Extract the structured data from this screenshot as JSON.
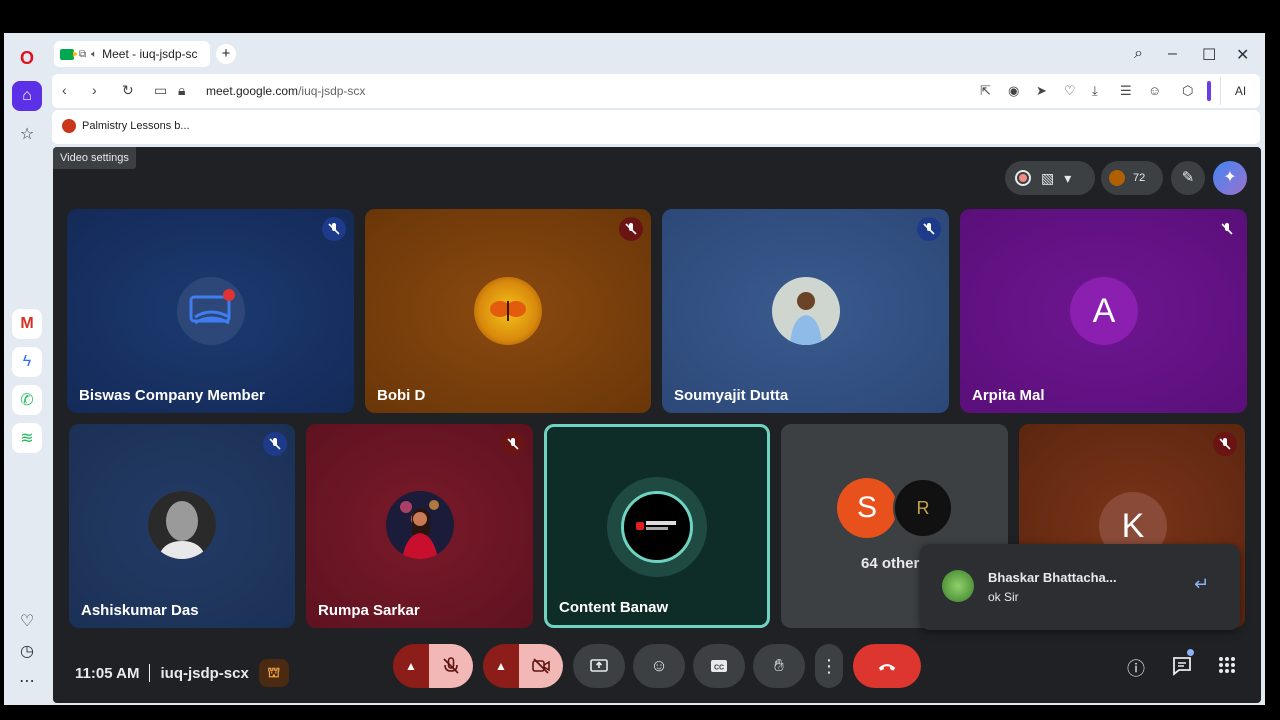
{
  "browser": {
    "tab_title": "Meet - iuq-jsdp-sc",
    "new_tab": "+",
    "url_host": "meet.google.com",
    "url_path": "/iuq-jsdp-scx",
    "ai_label": "AI",
    "bookmark": "Palmistry Lessons b..."
  },
  "meet": {
    "video_settings_tip": "Video settings",
    "participant_count": "72",
    "tiles": [
      {
        "name": "Biswas Company Member",
        "muted": true
      },
      {
        "name": "Bobi D",
        "muted": true
      },
      {
        "name": "Soumyajit Dutta",
        "muted": true
      },
      {
        "name": "Arpita Mal",
        "avatar_letter": "A",
        "muted": true
      },
      {
        "name": "Ashiskumar Das",
        "muted": true
      },
      {
        "name": "Rumpa Sarkar",
        "muted": true
      },
      {
        "name": "Content Banaw",
        "active_speaker": true
      },
      {
        "name": "64 other",
        "avatar_letters": [
          "S",
          "R"
        ]
      },
      {
        "name": "",
        "avatar_letter": "K",
        "muted": true
      }
    ],
    "notification": {
      "sender": "Bhaskar Bhattacha...",
      "message": "ok Sir"
    },
    "bottom": {
      "time": "11:05 AM",
      "meeting_code": "iuq-jsdp-scx"
    }
  },
  "colors": {
    "end_call": "#dc362e",
    "active_border": "#6fd3c2",
    "opera_accent": "#5b30e6"
  }
}
